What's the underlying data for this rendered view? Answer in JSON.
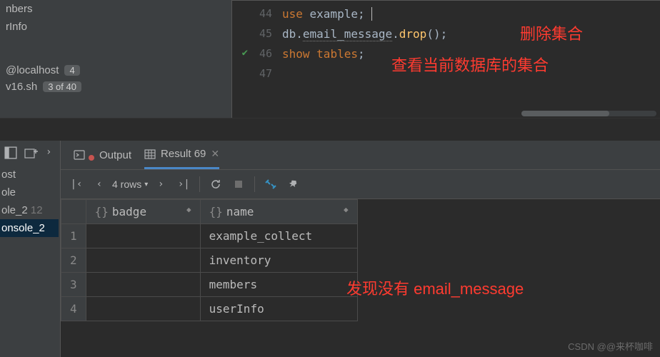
{
  "left_panel": {
    "item1": "nbers",
    "item2": "rInfo",
    "host": "@localhost",
    "host_badge": "4",
    "sh_file": "v16.sh",
    "sh_badge": "3 of 40"
  },
  "code": {
    "lines": [
      {
        "num": "44",
        "parts": [
          {
            "t": "use ",
            "c": "kw"
          },
          {
            "t": "example",
            "c": "ident"
          },
          {
            "t": ";",
            "c": "ident"
          }
        ],
        "cursor": true
      },
      {
        "num": "45",
        "parts": [
          {
            "t": "db",
            "c": "ident"
          },
          {
            "t": ".",
            "c": "ident"
          },
          {
            "t": "email_message",
            "c": "warn"
          },
          {
            "t": ".",
            "c": "ident"
          },
          {
            "t": "drop",
            "c": "func"
          },
          {
            "t": "();",
            "c": "ident"
          }
        ]
      },
      {
        "num": "46",
        "check": true,
        "parts": [
          {
            "t": "show ",
            "c": "kw"
          },
          {
            "t": "tables",
            "c": "kw"
          },
          {
            "t": ";",
            "c": "ident"
          }
        ]
      },
      {
        "num": "47",
        "parts": []
      }
    ]
  },
  "annotations": {
    "a1": "删除集合",
    "a2": "查看当前数据库的集合",
    "a3": "发现没有 email_message"
  },
  "console_list": [
    "ost",
    "ole",
    "ole_2",
    "onsole_2"
  ],
  "console_num": "12",
  "tabs": {
    "output": "Output",
    "result": "Result 69"
  },
  "toolbar": {
    "rows": "4 rows"
  },
  "table": {
    "columns": [
      "badge",
      "name"
    ],
    "rows": [
      {
        "badge": "",
        "name": "example_collect"
      },
      {
        "badge": "",
        "name": "inventory"
      },
      {
        "badge": "",
        "name": "members"
      },
      {
        "badge": "",
        "name": "userInfo"
      }
    ]
  },
  "watermark": "CSDN @@来杯咖啡"
}
